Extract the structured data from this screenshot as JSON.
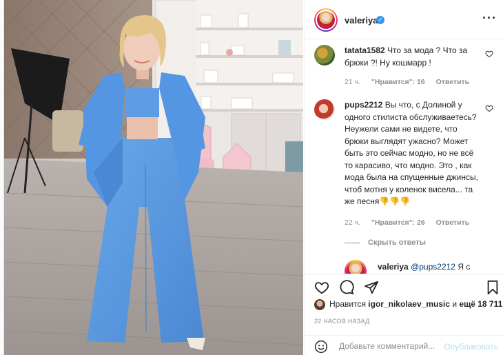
{
  "post": {
    "username": "valeriya",
    "verified_icon": "verified-badge-icon",
    "more_icon": "more-options-icon"
  },
  "comments": [
    {
      "username": "tatata1582",
      "text": "Что за мода ? Что за брюки ?! Ну кошмарр !",
      "time": "21 ч.",
      "likes": "\"Нравится\": 16",
      "reply": "Ответить"
    },
    {
      "username": "pups2212",
      "text": "Вы что, с Долиной у одного стилиста обслуживаетесь? Неужели сами не видете, что брюки выглядят ужасно? Может быть это сейчас модно, но не всё то карасиво, что модно. Это , как мода была на спущенные джинсы, чтоб мотня у коленок висела... та же песня👎👎👎",
      "time": "22 ч.",
      "likes": "\"Нравится\": 26",
      "reply": "Ответить"
    }
  ],
  "hide_replies": "Скрыть ответы",
  "partial_reply": {
    "username": "valeriya",
    "mention": "@pups2212",
    "text": "Я с"
  },
  "actions": {
    "liked_by_prefix": "Нравится",
    "liked_by_user": "igor_nikolaev_music",
    "liked_by_and": "и",
    "liked_by_others": "ещё 18 711",
    "time_ago": "22 ЧАСОВ НАЗАД",
    "comment_placeholder": "Добавьте комментарий...",
    "publish_label": "Опубликовать"
  },
  "colors": {
    "accent": "#3897f0",
    "suit": "#5b9be0",
    "link": "#00376b",
    "muted": "#8e8e8e"
  }
}
